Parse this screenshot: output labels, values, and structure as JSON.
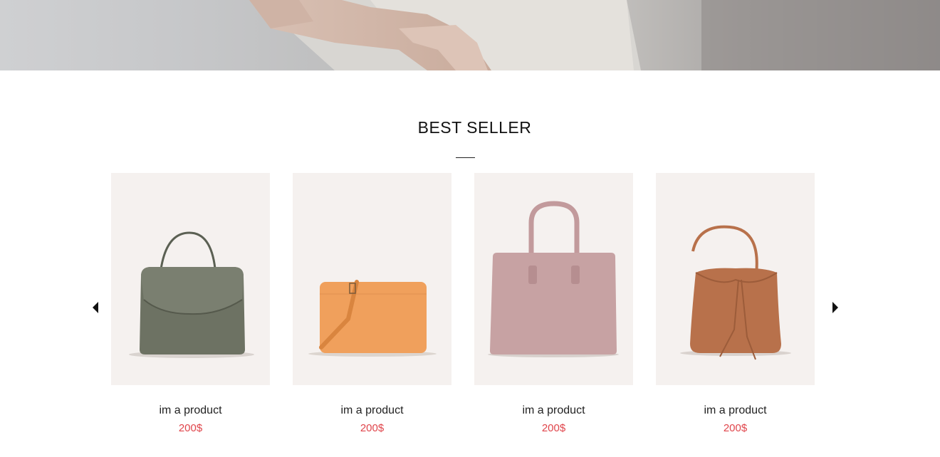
{
  "section": {
    "title": "BEST SELLER"
  },
  "carousel": {
    "prev_icon": "caret-left-icon",
    "next_icon": "caret-right-icon"
  },
  "products": [
    {
      "name": "im a product",
      "price": "200$",
      "color": "#6d7263"
    },
    {
      "name": "im a product",
      "price": "200$",
      "color": "#f0a05c"
    },
    {
      "name": "im a product",
      "price": "200$",
      "color": "#c7a2a3"
    },
    {
      "name": "im a product",
      "price": "200$",
      "color": "#b8714b"
    }
  ],
  "colors": {
    "price": "#e0454b",
    "card_bg": "#f5f1ef"
  }
}
